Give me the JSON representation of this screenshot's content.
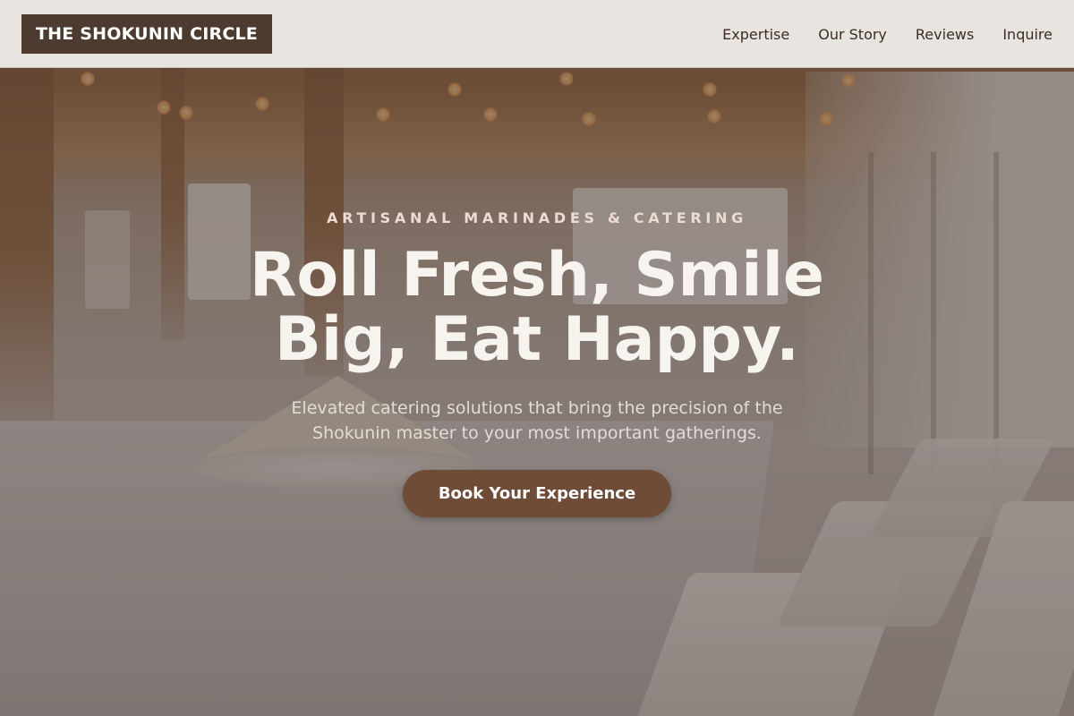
{
  "header": {
    "logo": "THE SHOKUNIN CIRCLE",
    "nav": [
      {
        "label": "Expertise"
      },
      {
        "label": "Our Story"
      },
      {
        "label": "Reviews"
      },
      {
        "label": "Inquire"
      }
    ]
  },
  "hero": {
    "eyebrow": "ARTISANAL MARINADES & CATERING",
    "headline": "Roll Fresh, Smile Big, Eat Happy.",
    "subtitle": "Elevated catering solutions that bring the precision of the Shokunin master to your most important gatherings.",
    "cta_label": "Book Your Experience"
  },
  "colors": {
    "logo_bg": "#4d3b30",
    "cta_bg": "#6e4c37",
    "header_bg": "#f2f0ed",
    "nav_text": "#3d2d24"
  }
}
